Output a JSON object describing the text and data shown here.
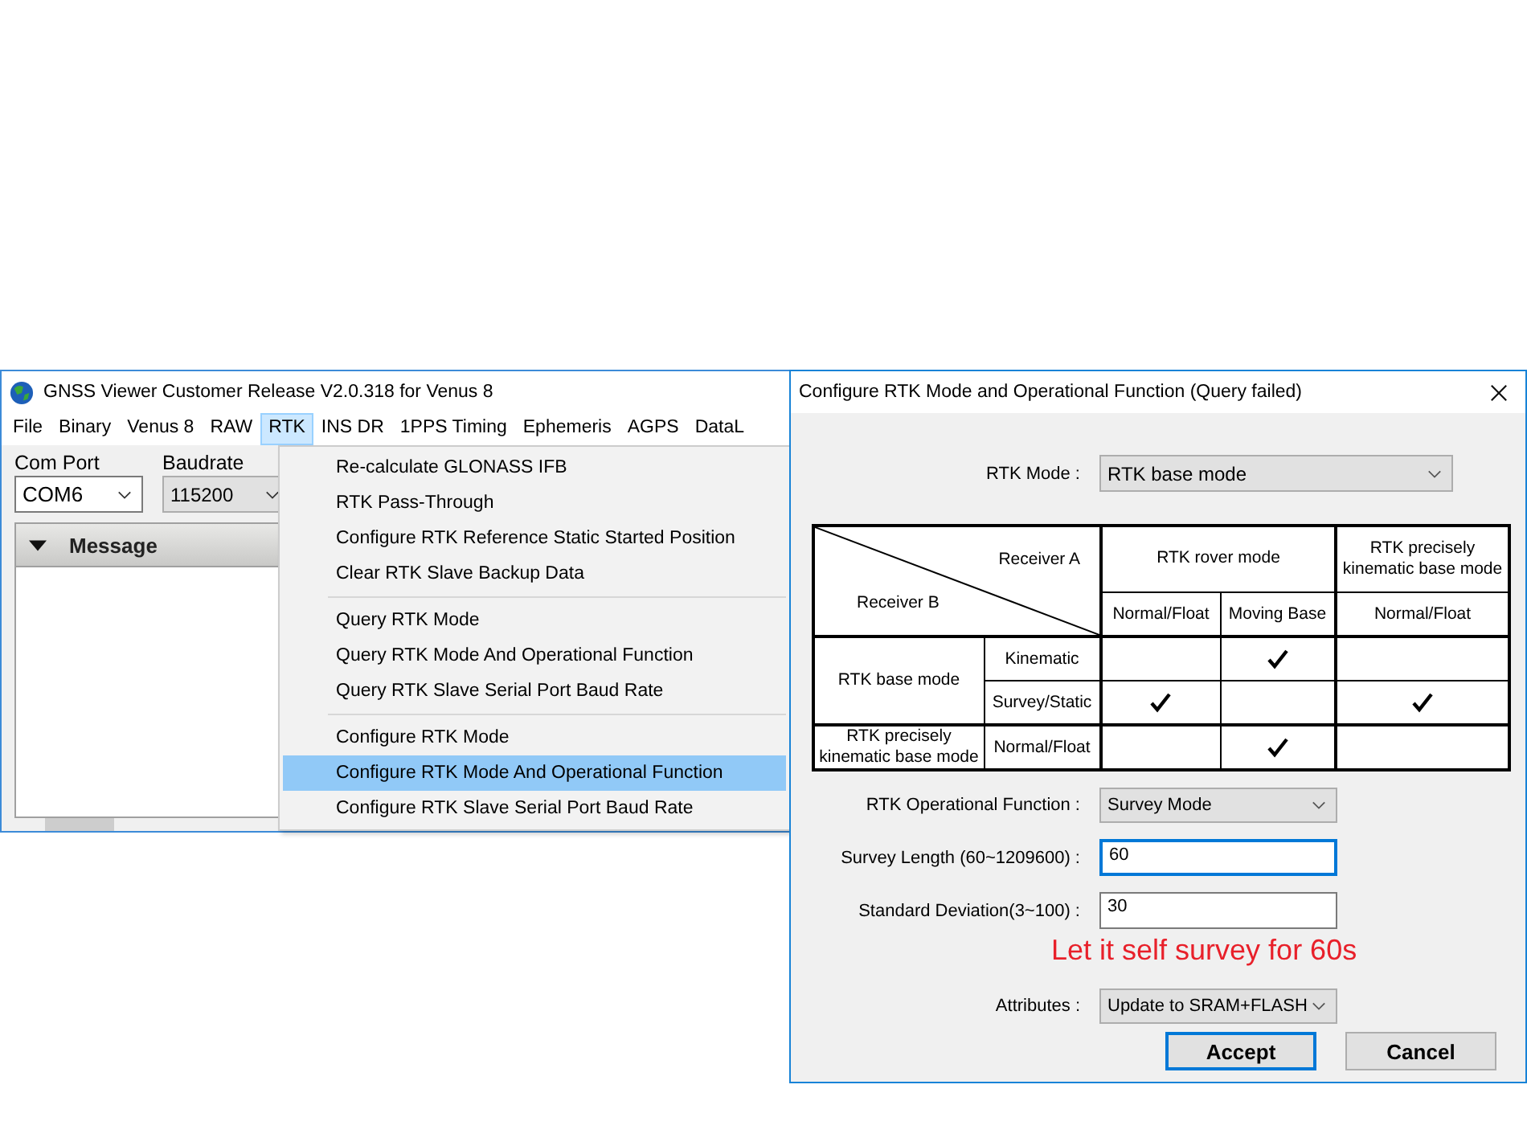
{
  "main_window": {
    "title": "GNSS Viewer Customer Release V2.0.318 for Venus 8",
    "menu": [
      {
        "label": "File",
        "selected": false
      },
      {
        "label": "Binary",
        "selected": false
      },
      {
        "label": "Venus 8",
        "selected": false
      },
      {
        "label": "RAW",
        "selected": false
      },
      {
        "label": "RTK",
        "selected": true
      },
      {
        "label": "INS DR",
        "selected": false
      },
      {
        "label": "1PPS Timing",
        "selected": false
      },
      {
        "label": "Ephemeris",
        "selected": false
      },
      {
        "label": "AGPS",
        "selected": false
      },
      {
        "label": "DataL",
        "selected": false
      }
    ],
    "com_port": {
      "label": "Com Port",
      "value": "COM6"
    },
    "baudrate": {
      "label": "Baudrate",
      "value": "115200"
    },
    "message_panel": {
      "title": "Message"
    }
  },
  "rtk_menu": {
    "groups": [
      [
        {
          "label": "Re-calculate GLONASS IFB",
          "selected": false
        },
        {
          "label": "RTK Pass-Through",
          "selected": false
        },
        {
          "label": "Configure RTK Reference Static Started Position",
          "selected": false
        },
        {
          "label": "Clear RTK Slave Backup Data",
          "selected": false
        }
      ],
      [
        {
          "label": "Query RTK Mode",
          "selected": false
        },
        {
          "label": "Query RTK Mode And Operational Function",
          "selected": false
        },
        {
          "label": "Query RTK Slave Serial Port Baud Rate",
          "selected": false
        }
      ],
      [
        {
          "label": "Configure RTK Mode",
          "selected": false
        },
        {
          "label": "Configure RTK Mode And Operational Function",
          "selected": true
        },
        {
          "label": "Configure RTK Slave Serial Port Baud Rate",
          "selected": false
        }
      ]
    ]
  },
  "dialog": {
    "title": "Configure RTK Mode and Operational Function (Query failed)",
    "rtk_mode": {
      "label": "RTK Mode :",
      "value": "RTK base mode"
    },
    "table": {
      "corner_top": "Receiver A",
      "corner_bottom": "Receiver B",
      "column_groups": [
        {
          "label": "RTK rover mode",
          "columns": [
            "Normal/Float",
            "Moving Base"
          ]
        },
        {
          "label": "RTK precisely kinematic base mode",
          "columns": [
            "Normal/Float"
          ]
        }
      ],
      "row_groups": [
        {
          "label": "RTK base mode",
          "rows": [
            {
              "label": "Kinematic",
              "checks": [
                false,
                true,
                false
              ]
            },
            {
              "label": "Survey/Static",
              "checks": [
                true,
                false,
                true
              ]
            }
          ]
        },
        {
          "label": "RTK precisely kinematic base mode",
          "rows": [
            {
              "label": "Normal/Float",
              "checks": [
                false,
                true,
                false
              ]
            }
          ]
        }
      ]
    },
    "fields": [
      {
        "kind": "dropdown",
        "label": "RTK Operational Function :",
        "value": "Survey Mode"
      },
      {
        "kind": "input",
        "label": "Survey Length (60~1209600) :",
        "value": "60",
        "focused": true
      },
      {
        "kind": "input",
        "label": "Standard Deviation(3~100) :",
        "value": "30",
        "focused": false
      },
      {
        "kind": "note",
        "label": "Let it self survey for 60s"
      },
      {
        "kind": "dropdown",
        "label": "Attributes :",
        "value": "Update to SRAM+FLASH"
      }
    ],
    "buttons": [
      {
        "label": "Accept",
        "default": true
      },
      {
        "label": "Cancel",
        "default": false
      }
    ]
  }
}
